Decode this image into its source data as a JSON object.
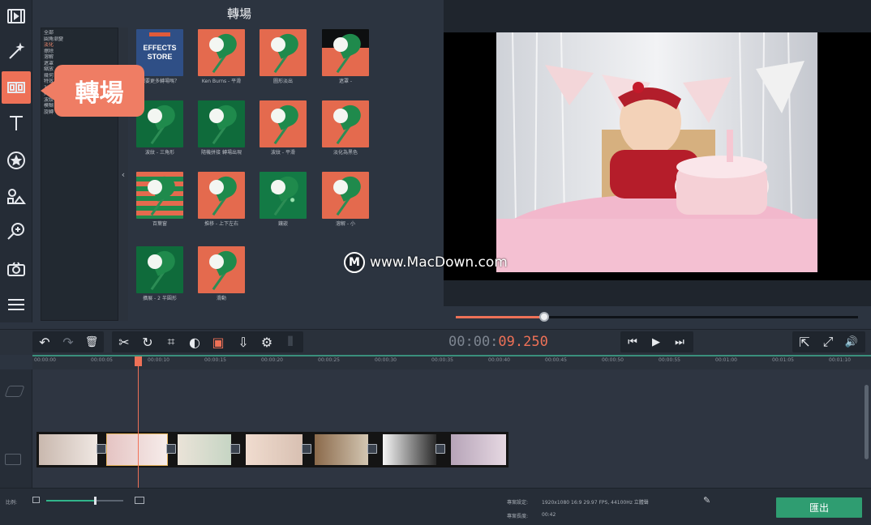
{
  "panel": {
    "title": "轉場",
    "categories": [
      "全部",
      "圓角漸變",
      "淡化",
      "擦除",
      "溶解",
      "遮罩",
      "縮放",
      "幾何",
      "特效",
      "3D",
      "其他",
      "波紋",
      "模糊",
      "旋轉"
    ],
    "selected_category_index": 2,
    "collapse_glyph": "‹",
    "tiles": [
      {
        "label": "想要更多轉場嗎？",
        "store_text": "EFFECTS STORE"
      },
      {
        "label": "Ken Burns - 平滑"
      },
      {
        "label": "圖形淡出"
      },
      {
        "label": "遮罩 - "
      },
      {
        "label": "波紋 - 三角形"
      },
      {
        "label": "隨機拼接 轉場出現"
      },
      {
        "label": "波紋 - 平滑"
      },
      {
        "label": "淡化為黑色"
      },
      {
        "label": "百葉窗"
      },
      {
        "label": "推移 - 上下左右"
      },
      {
        "label": "鑲嵌"
      },
      {
        "label": "溶解 - 小"
      },
      {
        "label": "擴展 - 2 半圓形"
      },
      {
        "label": "滑動"
      }
    ]
  },
  "callout": {
    "text": "轉場"
  },
  "left_tools": [
    {
      "name": "import",
      "icon": "film-import-icon"
    },
    {
      "name": "filters",
      "icon": "magic-wand-icon"
    },
    {
      "name": "transitions",
      "icon": "transitions-icon",
      "active": true
    },
    {
      "name": "titles",
      "icon": "text-t-icon"
    },
    {
      "name": "stickers",
      "icon": "star-circle-icon"
    },
    {
      "name": "shapes",
      "icon": "shapes-icon"
    },
    {
      "name": "zoom",
      "icon": "zoom-in-icon"
    },
    {
      "name": "capture",
      "icon": "camera-icon"
    },
    {
      "name": "more",
      "icon": "menu-lines-icon"
    }
  ],
  "preview": {
    "watermark_logo": "M",
    "watermark_text": "www.MacDown.com",
    "scrub_progress": 0.22
  },
  "toolbar": {
    "undo": "↶",
    "redo": "↷",
    "delete": "🗑",
    "cut": "✂",
    "rotate": "↻",
    "crop": "⌗",
    "color": "◐",
    "media": "▣",
    "audio": "⇩",
    "settings": "⚙",
    "levels": "⦀",
    "timecode_dim": "00:00:",
    "timecode_accent": "09.250",
    "prev": "⏮",
    "play": "▶",
    "next": "⏭",
    "popout": "⇱",
    "fullscreen": "⤢",
    "volume": "🔊"
  },
  "ruler": {
    "ticks": [
      "00:00:00",
      "00:00:05",
      "00:00:10",
      "00:00:15",
      "00:00:20",
      "00:00:25",
      "00:00:30",
      "00:00:35",
      "00:00:40",
      "00:00:45",
      "00:00:50",
      "00:00:55",
      "00:01:00",
      "00:01:05",
      "00:01:10"
    ]
  },
  "clips": [
    {
      "colors": [
        "#c9b8ae",
        "#efe7e2"
      ]
    },
    {
      "colors": [
        "#e5c4c3",
        "#f6ecea"
      ]
    },
    {
      "colors": [
        "#eae3d8",
        "#c6d5c4"
      ]
    },
    {
      "colors": [
        "#f0dccf",
        "#d8c0b2"
      ]
    },
    {
      "colors": [
        "#8b6a4b",
        "#d3c6b2"
      ]
    },
    {
      "colors": [
        "#f6f6f6",
        "#2a2a2a"
      ]
    },
    {
      "colors": [
        "#b6a4b8",
        "#e6d8e2"
      ]
    }
  ],
  "bottom": {
    "scale_label": "比例:",
    "zoom_level": 0.62,
    "project_settings_label": "專案設定:",
    "project_settings_value": "1920x1080 16:9 29.97 FPS, 44100Hz 立體聲",
    "duration_label": "專案長度:",
    "duration_value": "00:42",
    "export_label": "匯出",
    "edit_glyph": "✎"
  },
  "colors": {
    "accent": "#ee7157",
    "export": "#2f9d71",
    "timeline_line": "#3a8f7c"
  }
}
